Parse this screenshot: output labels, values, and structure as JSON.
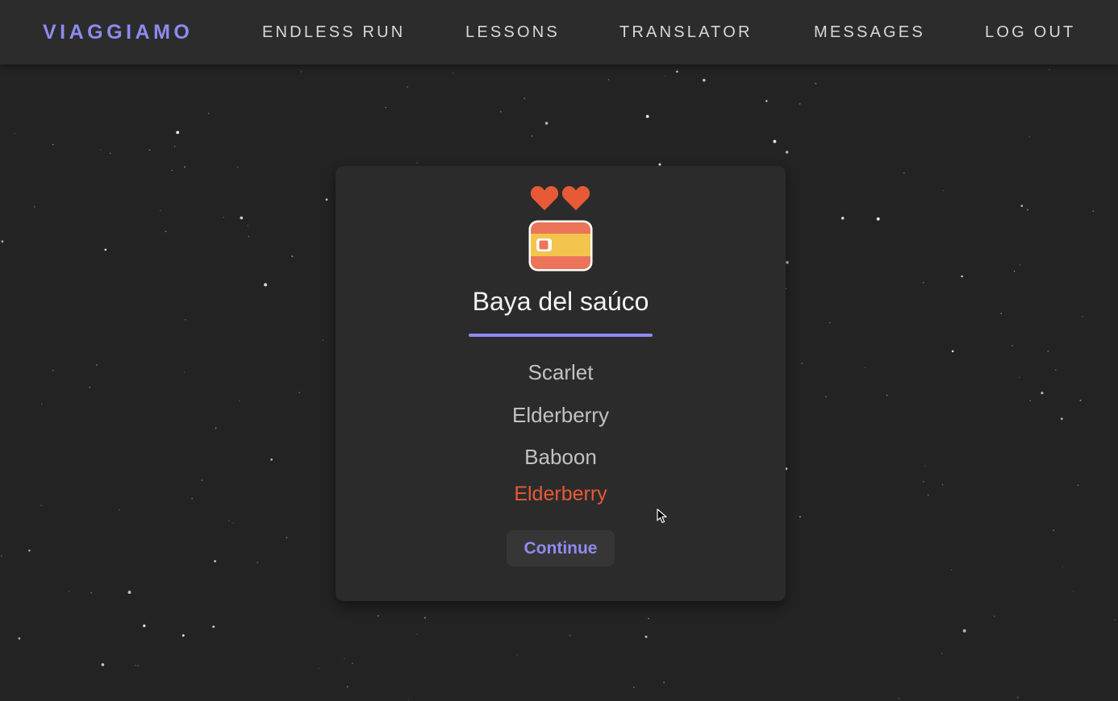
{
  "nav": {
    "brand": "VIAGGIAMO",
    "links": [
      "ENDLESS RUN",
      "LESSONS",
      "TRANSLATOR",
      "MESSAGES",
      "LOG OUT"
    ]
  },
  "quiz": {
    "lives": 2,
    "flag_icon": "spain-flag-icon",
    "word": "Baya del saúco",
    "options": [
      "Scarlet",
      "Elderberry",
      "Baboon"
    ],
    "correct_answer": "Elderberry",
    "continue_label": "Continue"
  },
  "colors": {
    "background": "#232323",
    "navbar": "#2c2c2c",
    "card": "#2b2b2b",
    "accent": "#8f8af0",
    "heart": "#e85a36",
    "answer": "#e85a36"
  }
}
